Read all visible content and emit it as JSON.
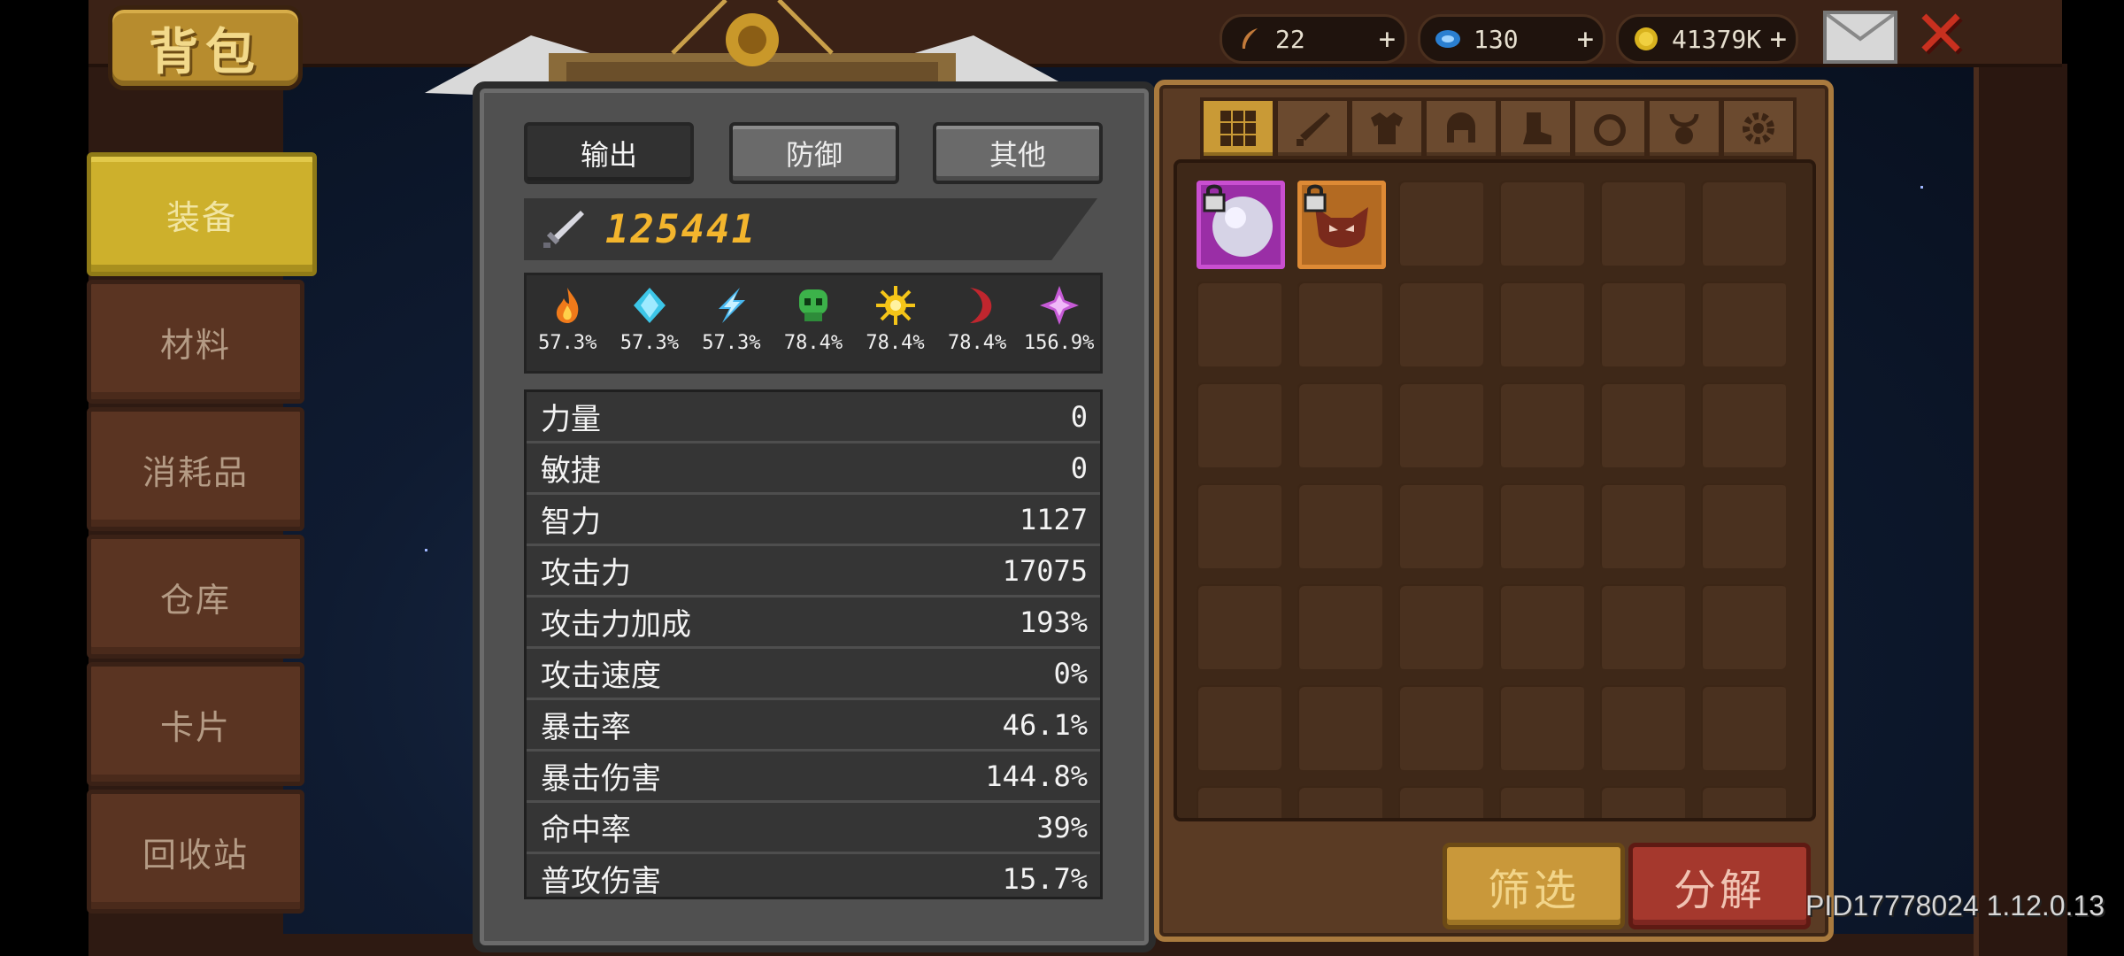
{
  "header": {
    "title": "背包"
  },
  "currencies": [
    {
      "icon": "feather-icon",
      "value": "22",
      "plus": "+"
    },
    {
      "icon": "blue-gem-icon",
      "value": "130",
      "plus": "+"
    },
    {
      "icon": "gold-coin-icon",
      "value": "41379K",
      "plus": "+"
    }
  ],
  "sidebar": {
    "items": [
      {
        "label": "装备",
        "active": true
      },
      {
        "label": "材料"
      },
      {
        "label": "消耗品"
      },
      {
        "label": "仓库"
      },
      {
        "label": "卡片"
      },
      {
        "label": "回收站"
      }
    ]
  },
  "stats": {
    "tabs": [
      {
        "label": "输出",
        "active": true
      },
      {
        "label": "防御"
      },
      {
        "label": "其他"
      }
    ],
    "power": "125441",
    "elements": [
      {
        "icon": "fire-icon",
        "value": "57.3%",
        "color": "#f07a1a"
      },
      {
        "icon": "ice-icon",
        "value": "57.3%",
        "color": "#3cc6e8"
      },
      {
        "icon": "lightning-icon",
        "value": "57.3%",
        "color": "#48b8f0"
      },
      {
        "icon": "poison-skull-icon",
        "value": "78.4%",
        "color": "#3cb24a"
      },
      {
        "icon": "sun-icon",
        "value": "78.4%",
        "color": "#f5c518"
      },
      {
        "icon": "dark-moon-icon",
        "value": "78.4%",
        "color": "#c0262e"
      },
      {
        "icon": "arcane-crystal-icon",
        "value": "156.9%",
        "color": "#c65ad6"
      }
    ],
    "rows": [
      {
        "label": "力量",
        "value": "0"
      },
      {
        "label": "敏捷",
        "value": "0"
      },
      {
        "label": "智力",
        "value": "1127"
      },
      {
        "label": "攻击力",
        "value": "17075"
      },
      {
        "label": "攻击力加成",
        "value": "193%"
      },
      {
        "label": "攻击速度",
        "value": "0%"
      },
      {
        "label": "暴击率",
        "value": "46.1%"
      },
      {
        "label": "暴击伤害",
        "value": "144.8%"
      },
      {
        "label": "命中率",
        "value": "39%"
      },
      {
        "label": "普攻伤害",
        "value": "15.7%"
      }
    ]
  },
  "inventory": {
    "categories": [
      "all-grid-icon",
      "weapon-icon",
      "armor-icon",
      "helmet-icon",
      "boots-icon",
      "ring-icon",
      "amulet-icon",
      "gear-icon"
    ],
    "items": [
      {
        "icon": "silver-orb-icon",
        "rarity": "purple",
        "locked": true
      },
      {
        "icon": "fox-mask-icon",
        "rarity": "orange",
        "locked": true
      }
    ],
    "filter_label": "筛选",
    "dismantle_label": "分解"
  },
  "footer": {
    "version": "PID17778024 1.12.0.13"
  }
}
